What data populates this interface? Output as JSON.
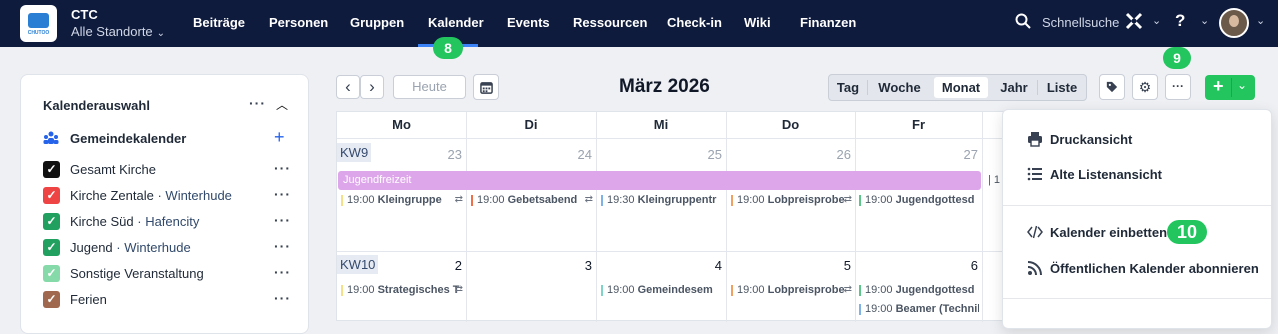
{
  "header": {
    "logo_text": "CHUTOO",
    "org_name": "CTC",
    "location": "Alle Standorte",
    "nav": [
      "Beiträge",
      "Personen",
      "Gruppen",
      "Kalender",
      "Events",
      "Ressourcen",
      "Check-in",
      "Wiki",
      "Finanzen"
    ],
    "active_nav": "Kalender",
    "search_label": "Schnellsuche",
    "help_label": "?"
  },
  "badges": {
    "b8": "8",
    "b9": "9",
    "b10": "10"
  },
  "sidebar": {
    "title": "Kalenderauswahl",
    "group_label": "Gemeindekalender",
    "calendars": [
      {
        "name": "Gesamt Kirche",
        "location": "",
        "color": "#111111"
      },
      {
        "name": "Kirche Zentale",
        "location": "Winterhude",
        "color": "#ef4444"
      },
      {
        "name": "Kirche Süd",
        "location": "Hafencity",
        "color": "#22a060"
      },
      {
        "name": "Jugend",
        "location": "Winterhude",
        "color": "#22a060"
      },
      {
        "name": "Sonstige Veranstaltung",
        "location": "",
        "color": "#86d9a8"
      },
      {
        "name": "Ferien",
        "location": "",
        "color": "#a0694f"
      }
    ],
    "separator": "·"
  },
  "toolbar": {
    "prev": "‹",
    "next": "›",
    "today": "Heute",
    "month_title": "März 2026",
    "views": [
      "Tag",
      "Woche",
      "Monat",
      "Jahr",
      "Liste"
    ],
    "active_view": "Monat",
    "add_label": "+",
    "more_label": "···"
  },
  "calendar": {
    "weekdays": [
      "Mo",
      "Di",
      "Mi",
      "Do",
      "Fr"
    ],
    "weeks": [
      {
        "kw": "KW9",
        "days": [
          "23",
          "24",
          "25",
          "26",
          "27"
        ]
      },
      {
        "kw": "KW10",
        "days": [
          "2",
          "3",
          "4",
          "5",
          "6"
        ]
      }
    ],
    "allday_event": "Jugendfreizeit",
    "events_week1": [
      {
        "time": "19:00",
        "title": "Kleingruppe",
        "color": "#f5e08a"
      },
      {
        "time": "19:00",
        "title": "Gebetsabend",
        "color": "#ef6f4a"
      },
      {
        "time": "19:30",
        "title": "Kleingruppentr",
        "color": "#7fb3e8"
      },
      {
        "time": "19:00",
        "title": "Lobpreisprobe",
        "color": "#f0a060"
      },
      {
        "time": "19:00",
        "title": "Jugendgottesd",
        "color": "#5cc58a"
      }
    ],
    "events_week2": [
      {
        "time": "19:00",
        "title": "Strategisches T",
        "color": "#f5e08a"
      },
      {
        "time": "19:00",
        "title": "Gemeindesem",
        "color": "#7fd4c8"
      },
      {
        "time": "19:00",
        "title": "Lobpreisprobe",
        "color": "#f0a060"
      },
      {
        "time": "19:00",
        "title": "Jugendgottesd",
        "color": "#5cc58a"
      },
      {
        "time": "19:00",
        "title": "Beamer (Technik)",
        "color": "#7fb3e8"
      }
    ],
    "overflow_marker": "| 1"
  },
  "dropdown": {
    "items": [
      {
        "label": "Druckansicht",
        "icon": "printer-icon"
      },
      {
        "label": "Alte Listenansicht",
        "icon": "list-icon"
      },
      {
        "label": "Kalender einbetten",
        "icon": "code-icon"
      },
      {
        "label": "Öffentlichen Kalender abonnieren",
        "icon": "rss-icon"
      }
    ]
  },
  "colors": {
    "topbar": "#0f1b3d",
    "accent": "#22c55e",
    "link": "#2563eb"
  }
}
